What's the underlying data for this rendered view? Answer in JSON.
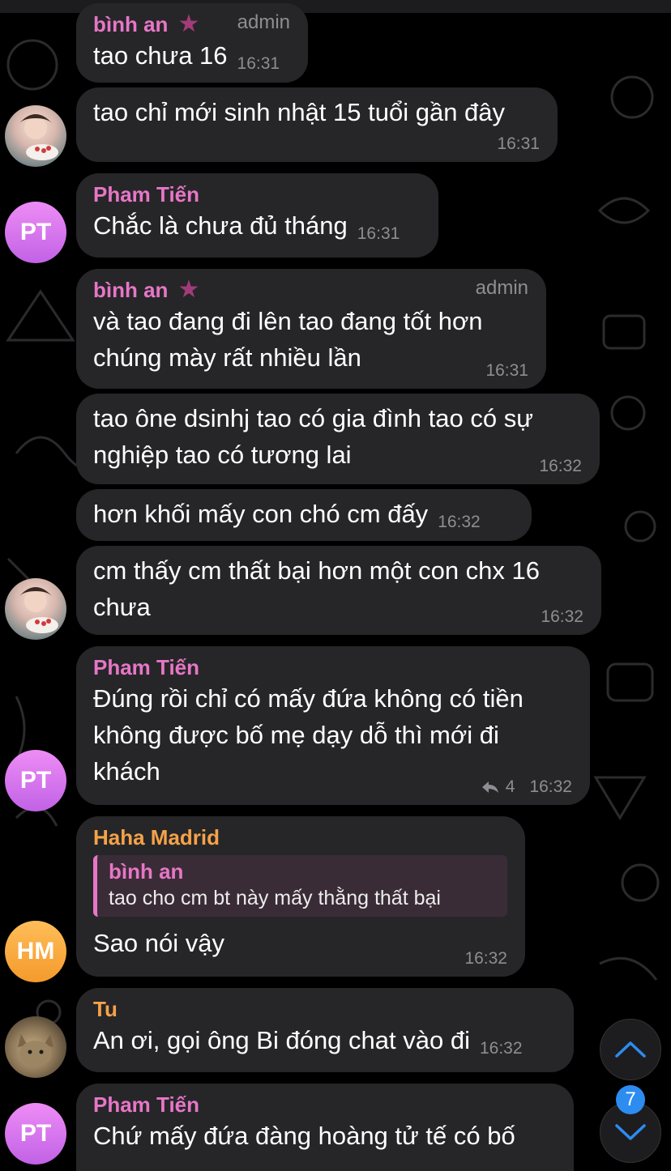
{
  "colors": {
    "background": "#000000",
    "bubble": "#262628",
    "name_pink": "#e776c7",
    "name_orange": "#f5a248",
    "meta_gray": "#8d8d93",
    "badge_blue": "#2d8cf0"
  },
  "messages": [
    {
      "sender": "bình an",
      "role": "admin",
      "text": "tao chưa 16",
      "time": "16:31"
    },
    {
      "text": "tao chỉ mới sinh nhật 15 tuổi gần đây",
      "time": "16:31"
    },
    {
      "sender": "Pham Tiến",
      "avatar": "PT",
      "text": "Chắc là chưa đủ tháng",
      "time": "16:31"
    },
    {
      "sender": "bình an",
      "role": "admin",
      "text_lines": [
        "và tao đang đi lên tao đang tốt hơn",
        "chúng mày rất nhiều lần"
      ],
      "time": "16:31"
    },
    {
      "text_lines": [
        "tao ône dsinhj tao có gia đình tao có sự",
        "nghiệp tao có tương lai"
      ],
      "time": "16:32"
    },
    {
      "text": "hơn khối mấy con chó cm đấy",
      "time": "16:32"
    },
    {
      "text_lines": [
        "cm thấy cm thất bại hơn một con chx 16",
        "chưa"
      ],
      "time": "16:32"
    },
    {
      "sender": "Pham Tiến",
      "avatar": "PT",
      "text_lines": [
        "Đúng rồi chỉ có mấy đứa không có tiền",
        "không được bố mẹ dạy dỗ thì mới đi",
        "khách"
      ],
      "reply_count": "4",
      "time": "16:32"
    },
    {
      "sender": "Haha Madrid",
      "avatar": "HM",
      "quote_name": "bình an",
      "quote_text": "tao cho cm bt này mấy thằng thất bại",
      "text": "Sao nói vậy",
      "time": "16:32"
    },
    {
      "sender": "Tu",
      "text": "An ơi, gọi ông Bi đóng chat vào đi",
      "time": "16:32"
    },
    {
      "sender": "Pham Tiến",
      "avatar": "PT",
      "text": "Chứ mấy đứa đàng hoàng tử tế có bố"
    }
  ],
  "controls": {
    "scroll_up_icon": "chevron-up-icon",
    "scroll_down_icon": "chevron-down-icon",
    "unread_badge": "7"
  }
}
